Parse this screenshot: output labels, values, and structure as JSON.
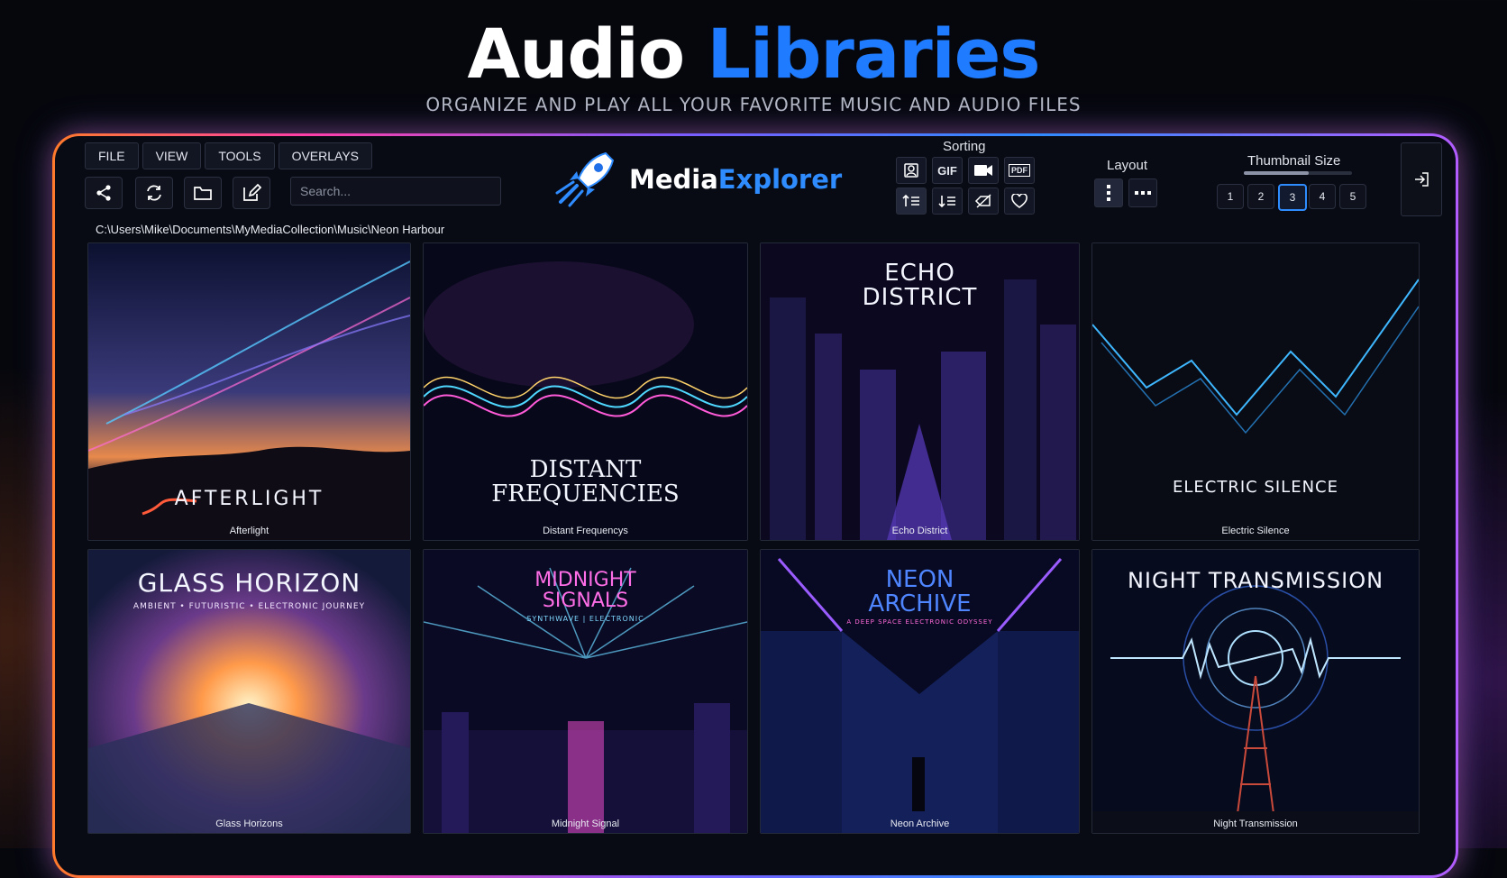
{
  "hero": {
    "title_white": "Audio",
    "title_blue": "Libraries",
    "subtitle": "ORGANIZE AND PLAY ALL YOUR FAVORITE MUSIC AND AUDIO FILES"
  },
  "menu": [
    "FILE",
    "VIEW",
    "TOOLS",
    "OVERLAYS"
  ],
  "toolbar": {
    "icons": [
      "share-icon",
      "refresh-icon",
      "folder-icon",
      "edit-icon"
    ],
    "search_placeholder": "Search..."
  },
  "logo": {
    "part1": "Media",
    "part2": "Explorer",
    "icon": "rocket-icon"
  },
  "sorting": {
    "label": "Sorting",
    "row1": [
      {
        "icon": "portrait-icon",
        "text": ""
      },
      {
        "icon": "gif-icon",
        "text": "GIF"
      },
      {
        "icon": "video-camera-icon",
        "text": ""
      },
      {
        "icon": "pdf-icon",
        "text": "PDF"
      }
    ],
    "row2": [
      "sort-ascending-icon",
      "sort-descending-icon",
      "tag-off-icon",
      "heart-icon"
    ]
  },
  "layout": {
    "label": "Layout",
    "options": [
      "vertical-dots-icon",
      "horizontal-dots-icon"
    ]
  },
  "thumbnail_size": {
    "label": "Thumbnail Size",
    "options": [
      "1",
      "2",
      "3",
      "4",
      "5"
    ],
    "selected": "3",
    "slider_level": 0.6
  },
  "exit_icon": "exit-icon",
  "path": "C:\\Users\\Mike\\Documents\\MyMediaCollection\\Music\\Neon Harbour",
  "albums": [
    {
      "art_title": "AFTERLIGHT",
      "art_subtitle": "",
      "caption": "Afterlight",
      "accent": "#ff9a5a"
    },
    {
      "art_title": "DISTANT\nFREQUENCIES",
      "art_subtitle": "",
      "caption": "Distant Frequencys",
      "accent": "#58d7ff"
    },
    {
      "art_title": "ECHO\nDISTRICT",
      "art_subtitle": "",
      "caption": "Echo District",
      "accent": "#9a5cff"
    },
    {
      "art_title": "ELECTRIC SILENCE",
      "art_subtitle": "",
      "caption": "Electric Silence",
      "accent": "#3fb7ff"
    },
    {
      "art_title": "GLASS HORIZON",
      "art_subtitle": "AMBIENT • FUTURISTIC • ELECTRONIC JOURNEY",
      "caption": "Glass Horizons",
      "accent": "#ff9a4a"
    },
    {
      "art_title": "MIDNIGHT\nSIGNALS",
      "art_subtitle": "SYNTHWAVE | ELECTRONIC",
      "caption": "Midnight Signal",
      "accent": "#ff4fd8"
    },
    {
      "art_title": "NEON\nARCHIVE",
      "art_subtitle": "A DEEP SPACE ELECTRONIC ODYSSEY",
      "caption": "Neon Archive",
      "accent": "#4f86ff"
    },
    {
      "art_title": "NIGHT TRANSMISSION",
      "art_subtitle": "",
      "caption": "Night Transmission",
      "accent": "#6fb6ff"
    }
  ]
}
